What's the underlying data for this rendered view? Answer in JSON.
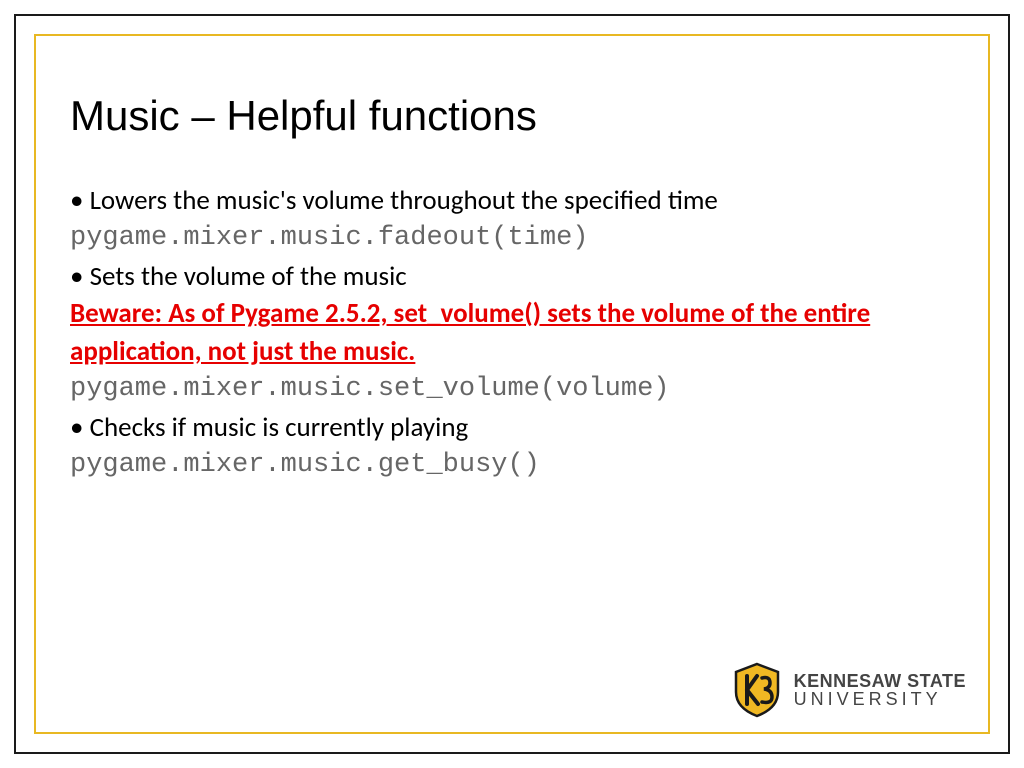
{
  "slide": {
    "title": "Music – Helpful functions",
    "items": [
      {
        "bullet": "• ",
        "text": "Lowers the music's volume throughout the specified time"
      },
      {
        "code": "pygame.mixer.music.fadeout(time)"
      },
      {
        "bullet": "• ",
        "text": "Sets the volume of the music"
      },
      {
        "warning": "Beware: As of Pygame 2.5.2, set_volume() sets the volume of the entire application, not just the music."
      },
      {
        "code": "pygame.mixer.music.set_volume(volume)"
      },
      {
        "bullet": "• ",
        "text": "Checks if music is currently playing"
      },
      {
        "code": "pygame.mixer.music.get_busy()"
      }
    ]
  },
  "logo": {
    "line1": "KENNESAW STATE",
    "line2": "UNIVERSITY"
  }
}
